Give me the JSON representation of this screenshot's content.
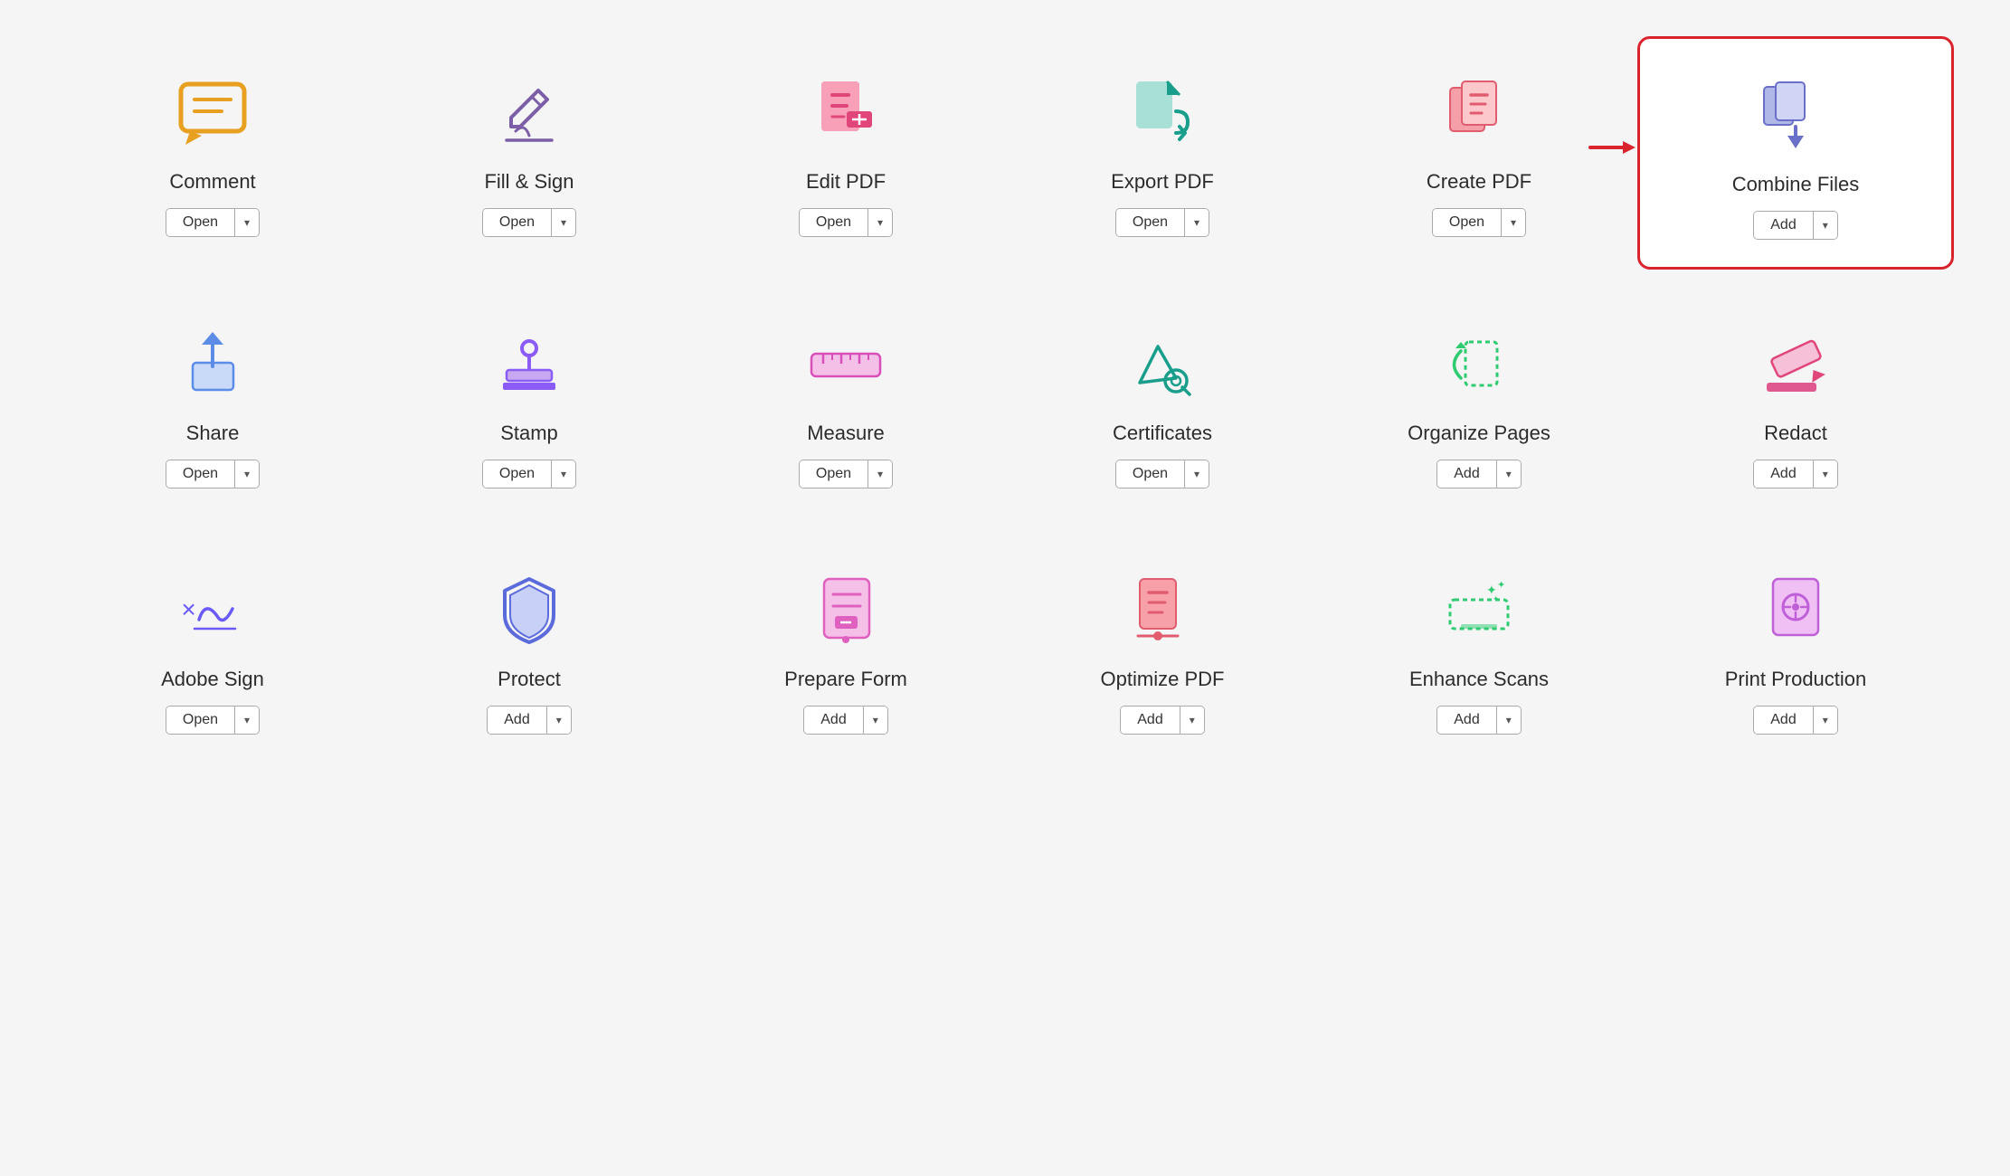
{
  "tools": [
    [
      {
        "id": "comment",
        "label": "Comment",
        "button": "Open",
        "highlighted": false,
        "iconColor": "#e8a020"
      },
      {
        "id": "fill-sign",
        "label": "Fill & Sign",
        "button": "Open",
        "highlighted": false,
        "iconColor": "#7b5ea7"
      },
      {
        "id": "edit-pdf",
        "label": "Edit PDF",
        "button": "Open",
        "highlighted": false,
        "iconColor": "#e0467a"
      },
      {
        "id": "export-pdf",
        "label": "Export PDF",
        "button": "Open",
        "highlighted": false,
        "iconColor": "#1a9e8c"
      },
      {
        "id": "create-pdf",
        "label": "Create PDF",
        "button": "Open",
        "highlighted": false,
        "iconColor": "#e05c6e"
      },
      {
        "id": "combine-files",
        "label": "Combine Files",
        "button": "Add",
        "highlighted": true,
        "iconColor": "#6a6fc8"
      }
    ],
    [
      {
        "id": "share",
        "label": "Share",
        "button": "Open",
        "highlighted": false,
        "iconColor": "#5b8de8"
      },
      {
        "id": "stamp",
        "label": "Stamp",
        "button": "Open",
        "highlighted": false,
        "iconColor": "#8b5cf6"
      },
      {
        "id": "measure",
        "label": "Measure",
        "button": "Open",
        "highlighted": false,
        "iconColor": "#d94fba"
      },
      {
        "id": "certificates",
        "label": "Certificates",
        "button": "Open",
        "highlighted": false,
        "iconColor": "#1a9e8c"
      },
      {
        "id": "organize-pages",
        "label": "Organize Pages",
        "button": "Add",
        "highlighted": false,
        "iconColor": "#2ecc71"
      },
      {
        "id": "redact",
        "label": "Redact",
        "button": "Add",
        "highlighted": false,
        "iconColor": "#e0467a"
      }
    ],
    [
      {
        "id": "adobe-sign",
        "label": "Adobe Sign",
        "button": "Open",
        "highlighted": false,
        "iconColor": "#6a5af9"
      },
      {
        "id": "protect",
        "label": "Protect",
        "button": "Add",
        "highlighted": false,
        "iconColor": "#5b6bdc"
      },
      {
        "id": "prepare-form",
        "label": "Prepare Form",
        "button": "Add",
        "highlighted": false,
        "iconColor": "#e060c0"
      },
      {
        "id": "optimize-pdf",
        "label": "Optimize PDF",
        "button": "Add",
        "highlighted": false,
        "iconColor": "#e05c6e"
      },
      {
        "id": "enhance-scans",
        "label": "Enhance Scans",
        "button": "Add",
        "highlighted": false,
        "iconColor": "#2ecc71"
      },
      {
        "id": "print-production",
        "label": "Print Production",
        "button": "Add",
        "highlighted": false,
        "iconColor": "#c060d8"
      }
    ]
  ],
  "arrow": "→"
}
